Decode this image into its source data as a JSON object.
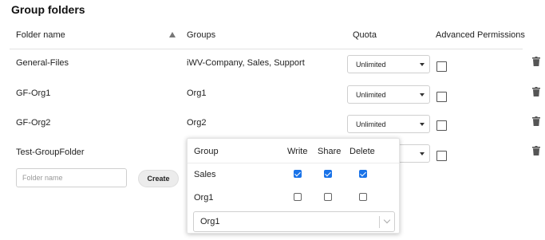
{
  "title": "Group folders",
  "headers": {
    "folder_name": "Folder name",
    "groups": "Groups",
    "quota": "Quota",
    "advanced_permissions": "Advanced Permissions"
  },
  "rows": [
    {
      "name": "General-Files",
      "groups": "iWV-Company, Sales, Support",
      "quota": "Unlimited",
      "advanced": false
    },
    {
      "name": "GF-Org1",
      "groups": "Org1",
      "quota": "Unlimited",
      "advanced": false
    },
    {
      "name": "GF-Org2",
      "groups": "Org2",
      "quota": "Unlimited",
      "advanced": false
    },
    {
      "name": "Test-GroupFolder",
      "groups": "",
      "quota": "",
      "advanced": false
    }
  ],
  "new_folder": {
    "placeholder": "Folder name",
    "create_label": "Create"
  },
  "group_popover": {
    "headers": {
      "group": "Group",
      "write": "Write",
      "share": "Share",
      "delete": "Delete"
    },
    "groups": [
      {
        "name": "Sales",
        "write": true,
        "share": true,
        "delete": true
      },
      {
        "name": "Org1",
        "write": false,
        "share": false,
        "delete": false
      }
    ],
    "select_value": "Org1"
  },
  "icons": {
    "sort": "sort-ascending-icon",
    "dropdown": "chevron-down-icon",
    "delete": "trash-icon"
  },
  "colors": {
    "checkbox_checked": "#1a73e8"
  }
}
